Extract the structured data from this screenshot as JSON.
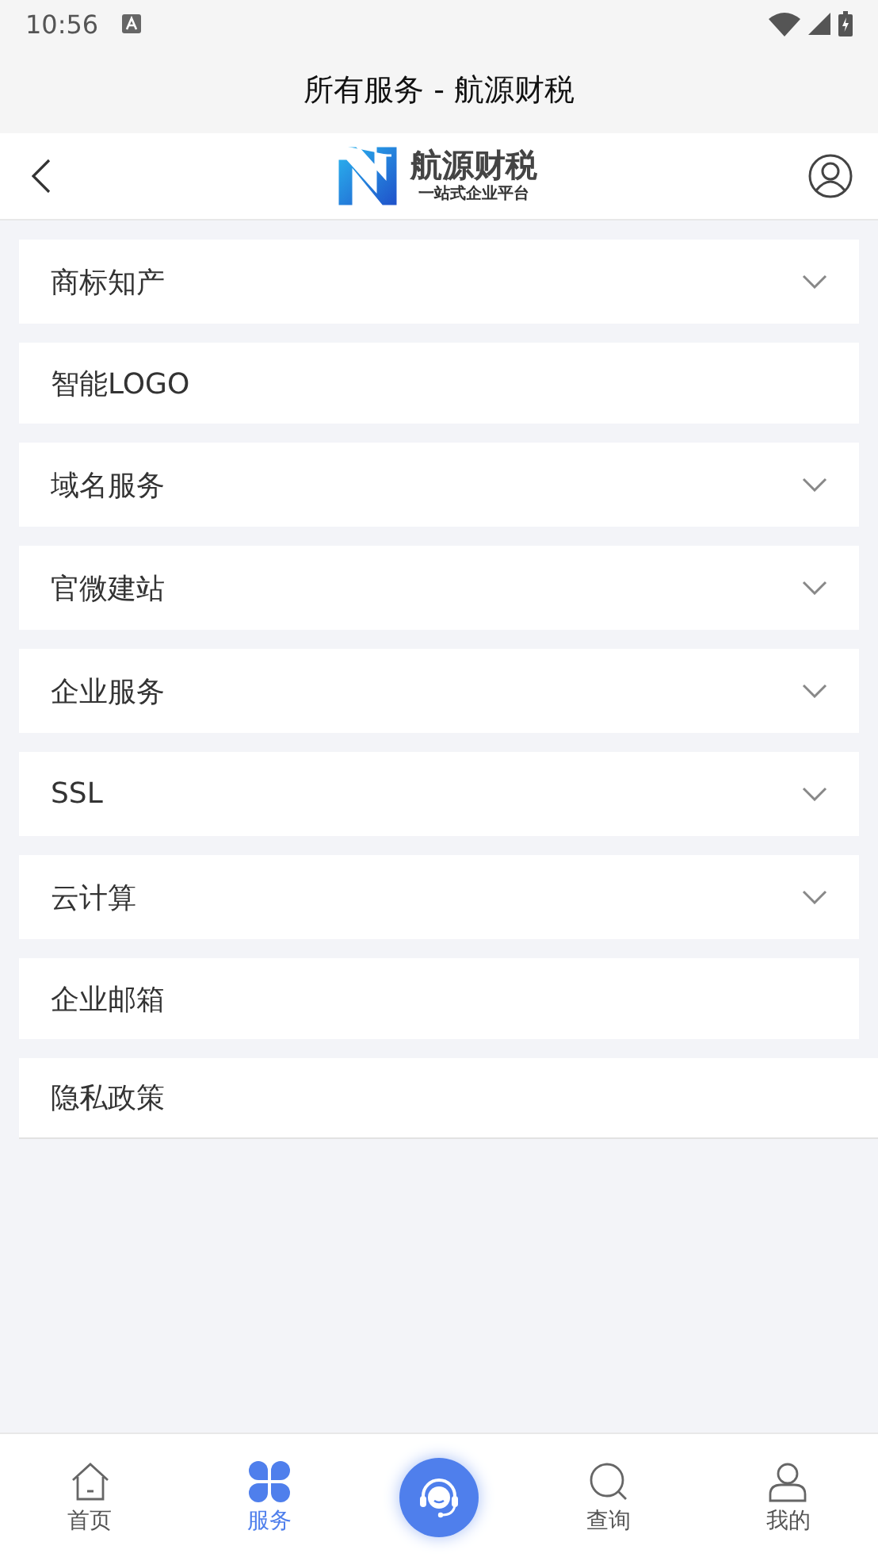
{
  "status_bar": {
    "time": "10:56"
  },
  "window": {
    "title": "所有服务 - 航源财税"
  },
  "header": {
    "brand": "航源财税",
    "tagline": "一站式企业平台"
  },
  "menu": [
    {
      "label": "商标知产",
      "kind": "expandable"
    },
    {
      "label": "智能LOGO",
      "kind": "link"
    },
    {
      "label": "域名服务",
      "kind": "expandable"
    },
    {
      "label": "官微建站",
      "kind": "expandable"
    },
    {
      "label": "企业服务",
      "kind": "expandable"
    },
    {
      "label": "SSL",
      "kind": "expandable"
    },
    {
      "label": "云计算",
      "kind": "expandable"
    },
    {
      "label": "企业邮箱",
      "kind": "link"
    },
    {
      "label": "隐私政策",
      "kind": "link"
    }
  ],
  "tab_bar": [
    {
      "kind": "home",
      "label": "首页",
      "selected": false
    },
    {
      "kind": "services",
      "label": "服务",
      "selected": true
    },
    {
      "kind": "support"
    },
    {
      "kind": "search",
      "label": "查询",
      "selected": false
    },
    {
      "kind": "profile",
      "label": "我的",
      "selected": false
    }
  ]
}
